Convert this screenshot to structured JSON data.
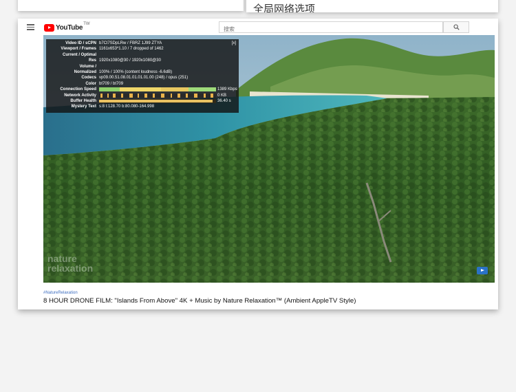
{
  "top_right_card": {
    "text": "全局网络选项"
  },
  "header": {
    "logo_text": "YouTube",
    "logo_region": "TW",
    "search_placeholder": "搜索"
  },
  "stats": {
    "close_label": "[x]",
    "rows": [
      {
        "key": "Video ID / sCPN",
        "value": "b7Cl7SDpLRw / FBRZ 1J99 ZTYA"
      },
      {
        "key": "Viewport / Frames",
        "value": "1161x653*1.10 / 7 dropped of 1462"
      },
      {
        "key": "Current / Optimal",
        "value": ""
      },
      {
        "key": "Res",
        "value": "1920x1080@30 / 1920x1080@30"
      },
      {
        "key": "Volume /",
        "value": ""
      },
      {
        "key": "Normalized",
        "value": "100% / 100% (content loudness -6.6dB)"
      },
      {
        "key": "Codecs",
        "value": "vp09.00.51.08.01.01.01.01.00 (248) / opus (251)"
      },
      {
        "key": "Color",
        "value": "bt709 / bt709"
      },
      {
        "key": "Connection Speed",
        "value": "1389 Kbps"
      },
      {
        "key": "Network Activity",
        "value": "0 KB"
      },
      {
        "key": "Buffer Health",
        "value": "36.40 s"
      },
      {
        "key": "Mystery Text",
        "value": "s:8 t:128.70 b:80.080-164.998"
      }
    ]
  },
  "video": {
    "watermark_line1": "nature",
    "watermark_line2": "relaxation"
  },
  "hashtag": "#NatureRelaxation",
  "title": "8 HOUR DRONE FILM: \"Islands From Above\" 4K + Music by Nature Relaxation™ (Ambient AppleTV Style)",
  "colors": {
    "logo_red": "#ff0000",
    "hashtag_blue": "#3e6ec0"
  }
}
